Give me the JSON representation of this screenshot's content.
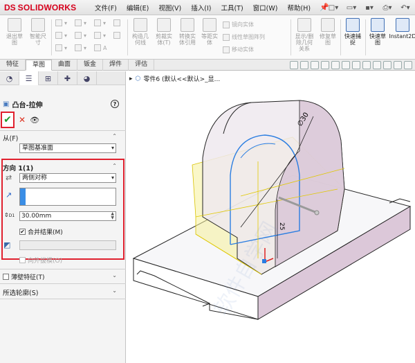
{
  "app": {
    "logo_ds": "DS",
    "logo_text": "SOLIDWORKS"
  },
  "menu": [
    "文件(F)",
    "编辑(E)",
    "视图(V)",
    "插入(I)",
    "工具(T)",
    "窗口(W)",
    "帮助(H)"
  ],
  "ribbon": {
    "exit_sketch": "退出草\n图",
    "smart_dim": "智能尺\n寸",
    "convert": "构造几\n何线",
    "trim": "剪裁实\n体(T)",
    "convert_entities": "转换实\n体引用",
    "offset": "等距实\n体",
    "mirror": "镜向实体",
    "linear_pattern": "线性草图阵列",
    "move": "移动实体",
    "display_relations": "显示/删\n除几何\n关系",
    "repair": "修复草\n图",
    "quick_snaps": "快速捕\n捉",
    "rapid_sketch": "快速草\n图",
    "instant2d": "Instant2D"
  },
  "tabs": [
    "特征",
    "草图",
    "曲面",
    "钣金",
    "焊件",
    "评估"
  ],
  "active_tab": "草图",
  "panel": {
    "feature_title": "凸台-拉伸",
    "from_label": "从(F)",
    "from_value": "草图基准面",
    "dir1_label": "方向 1(1)",
    "dir1_type": "两侧对称",
    "depth": "30.00mm",
    "depth_unit_label": "D1",
    "merge_result": "合并结果(M)",
    "draft_outward": "向外拔模(O)",
    "thin_feature": "薄壁特征(T)",
    "selected_contours": "所选轮廓(S)"
  },
  "viewport": {
    "tree_path": "零件6 (默认<<默认>_显...",
    "dim_diameter": "∅30",
    "dim_height": "25"
  },
  "colors": {
    "brand": "#d6001c",
    "highlight": "#e0202e",
    "model_face": "#d9c6d6",
    "preview": "#f5ee8a",
    "sketch": "#2a7de1"
  }
}
